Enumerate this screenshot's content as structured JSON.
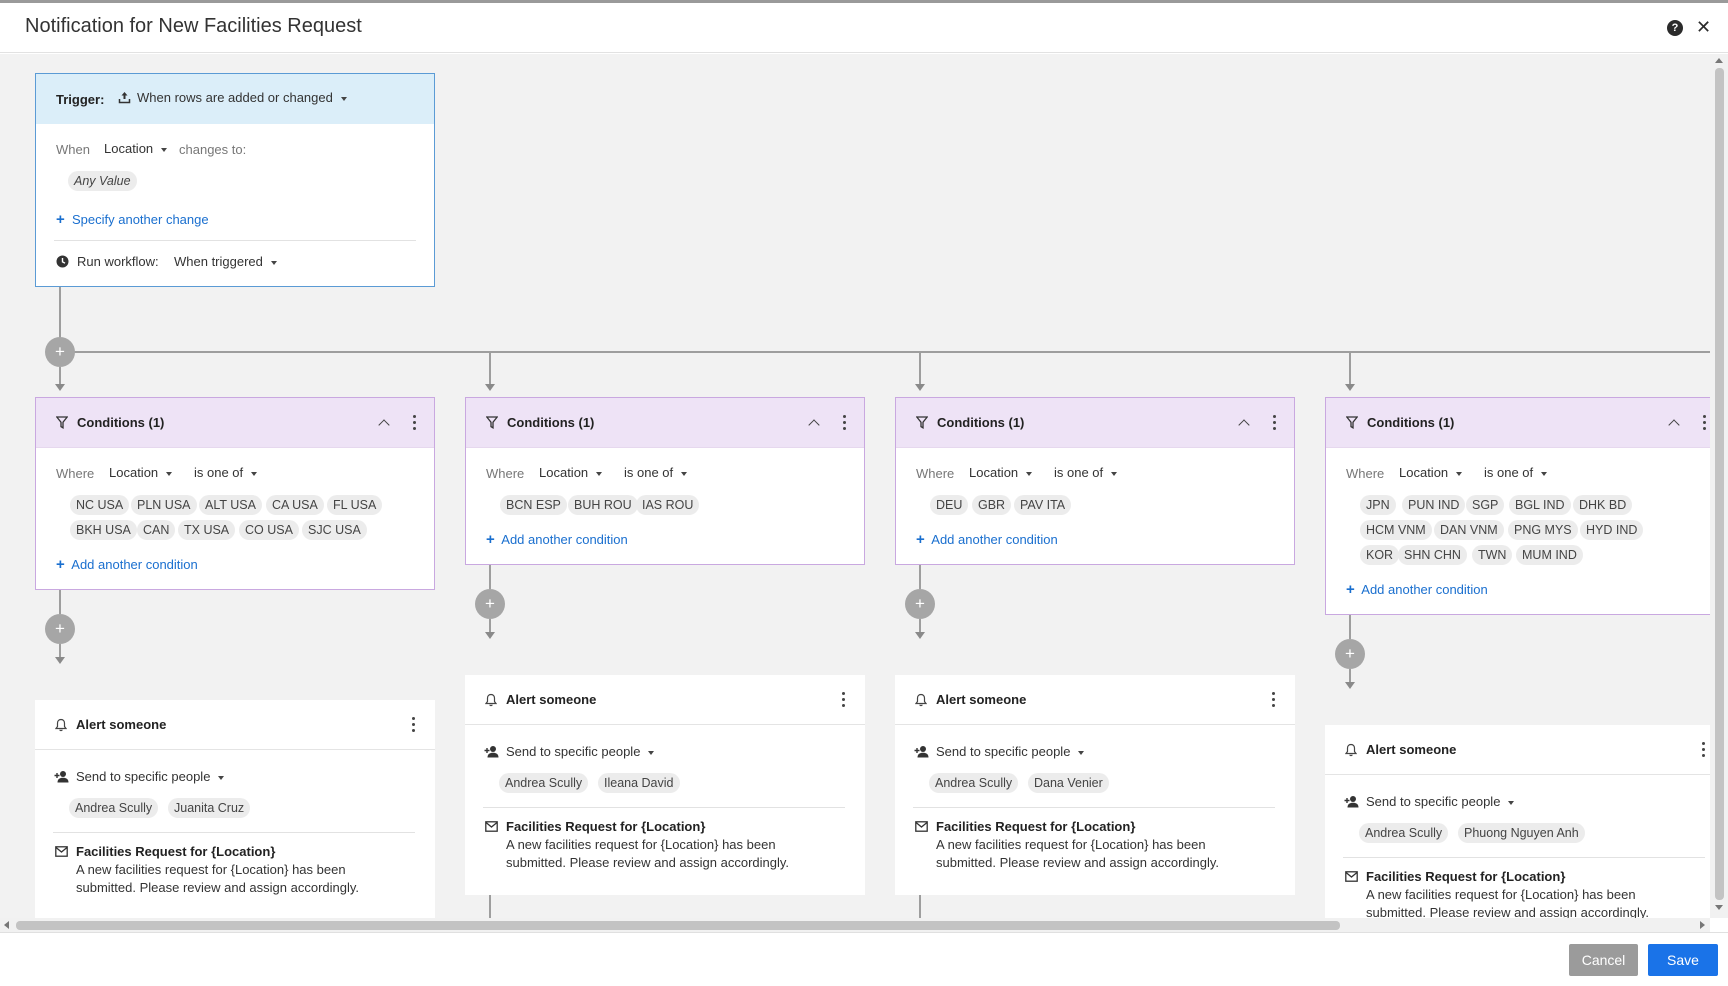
{
  "window": {
    "title": "Notification for New Facilities Request"
  },
  "trigger": {
    "label": "Trigger:",
    "type_value": "When rows are added or changed",
    "when_label": "When",
    "field_value": "Location",
    "changes_label": "changes to:",
    "any_value": "Any Value",
    "specify_link": "Specify another change",
    "run_label": "Run workflow:",
    "run_value": "When triggered"
  },
  "branches": [
    {
      "condition": {
        "title": "Conditions (1)",
        "where": "Where",
        "field": "Location",
        "operator": "is one of",
        "values": [
          "NC USA",
          "PLN USA",
          "ALT USA",
          "CA USA",
          "FL USA",
          "BKH USA",
          "CAN",
          "TX USA",
          "CO USA",
          "SJC USA"
        ],
        "add_link": "Add another condition"
      },
      "alert": {
        "title": "Alert someone",
        "send_to": "Send to specific people",
        "people": [
          "Andrea Scully",
          "Juanita Cruz"
        ],
        "message_title": "Facilities Request for {Location}",
        "message_body_1": "A new facilities request for {Location} has been",
        "message_body_2": "submitted. Please review and assign accordingly."
      }
    },
    {
      "condition": {
        "title": "Conditions (1)",
        "where": "Where",
        "field": "Location",
        "operator": "is one of",
        "values": [
          "BCN ESP",
          "BUH ROU",
          "IAS ROU"
        ],
        "add_link": "Add another condition"
      },
      "alert": {
        "title": "Alert someone",
        "send_to": "Send to specific people",
        "people": [
          "Andrea Scully",
          "Ileana David"
        ],
        "message_title": "Facilities Request for {Location}",
        "message_body_1": "A new facilities request for {Location} has been",
        "message_body_2": "submitted. Please review and assign accordingly."
      }
    },
    {
      "condition": {
        "title": "Conditions (1)",
        "where": "Where",
        "field": "Location",
        "operator": "is one of",
        "values": [
          "DEU",
          "GBR",
          "PAV ITA"
        ],
        "add_link": "Add another condition"
      },
      "alert": {
        "title": "Alert someone",
        "send_to": "Send to specific people",
        "people": [
          "Andrea Scully",
          "Dana Venier"
        ],
        "message_title": "Facilities Request for {Location}",
        "message_body_1": "A new facilities request for {Location} has been",
        "message_body_2": "submitted. Please review and assign accordingly."
      }
    },
    {
      "condition": {
        "title": "Conditions (1)",
        "where": "Where",
        "field": "Location",
        "operator": "is one of",
        "values": [
          "JPN",
          "PUN IND",
          "SGP",
          "BGL IND",
          "DHK BD",
          "HCM VNM",
          "DAN VNM",
          "PNG MYS",
          "HYD IND",
          "KOR",
          "SHN CHN",
          "TWN",
          "MUM IND"
        ],
        "add_link": "Add another condition"
      },
      "alert": {
        "title": "Alert someone",
        "send_to": "Send to specific people",
        "people": [
          "Andrea Scully",
          "Phuong Nguyen Anh"
        ],
        "message_title": "Facilities Request for {Location}",
        "message_body_1": "A new facilities request for {Location} has been",
        "message_body_2": "submitted. Please review and assign accordingly."
      }
    }
  ],
  "footer": {
    "cancel_label": "Cancel",
    "save_label": "Save"
  },
  "colors": {
    "accent": "#1a73e8",
    "trigger_header": "#dbeef9",
    "condition_header": "#eee3f6",
    "link": "#1a6fcf"
  },
  "icons": [
    "help-icon",
    "close-icon",
    "upload-icon",
    "clock-icon",
    "filter-icon",
    "chevron-up-icon",
    "more-vert-icon",
    "bell-icon",
    "person-add-icon",
    "mail-icon",
    "plus-icon"
  ]
}
